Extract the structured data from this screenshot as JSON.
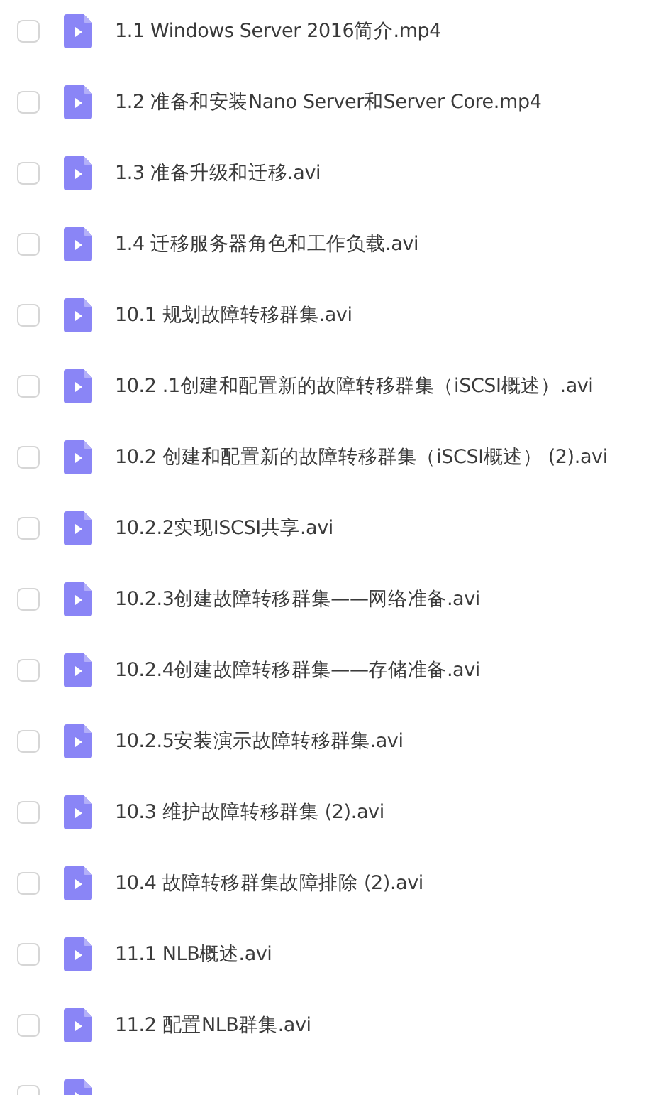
{
  "files": [
    {
      "name": "1.1 Windows Server 2016简介.mp4",
      "checked": false
    },
    {
      "name": "1.2 准备和安装Nano Server和Server Core.mp4",
      "checked": false
    },
    {
      "name": "1.3 准备升级和迁移.avi",
      "checked": false
    },
    {
      "name": "1.4 迁移服务器角色和工作负载.avi",
      "checked": false
    },
    {
      "name": "10.1 规划故障转移群集.avi",
      "checked": false
    },
    {
      "name": "10.2 .1创建和配置新的故障转移群集（iSCSI概述）.avi",
      "checked": false
    },
    {
      "name": "10.2 创建和配置新的故障转移群集（iSCSI概述） (2).avi",
      "checked": false
    },
    {
      "name": "10.2.2实现ISCSI共享.avi",
      "checked": false
    },
    {
      "name": "10.2.3创建故障转移群集——网络准备.avi",
      "checked": false
    },
    {
      "name": "10.2.4创建故障转移群集——存储准备.avi",
      "checked": false
    },
    {
      "name": "10.2.5安装演示故障转移群集.avi",
      "checked": false
    },
    {
      "name": "10.3 维护故障转移群集 (2).avi",
      "checked": false
    },
    {
      "name": "10.4 故障转移群集故障排除 (2).avi",
      "checked": false
    },
    {
      "name": "11.1 NLB概述.avi",
      "checked": false
    },
    {
      "name": "11.2 配置NLB群集.avi",
      "checked": false
    },
    {
      "checked": false
    }
  ]
}
